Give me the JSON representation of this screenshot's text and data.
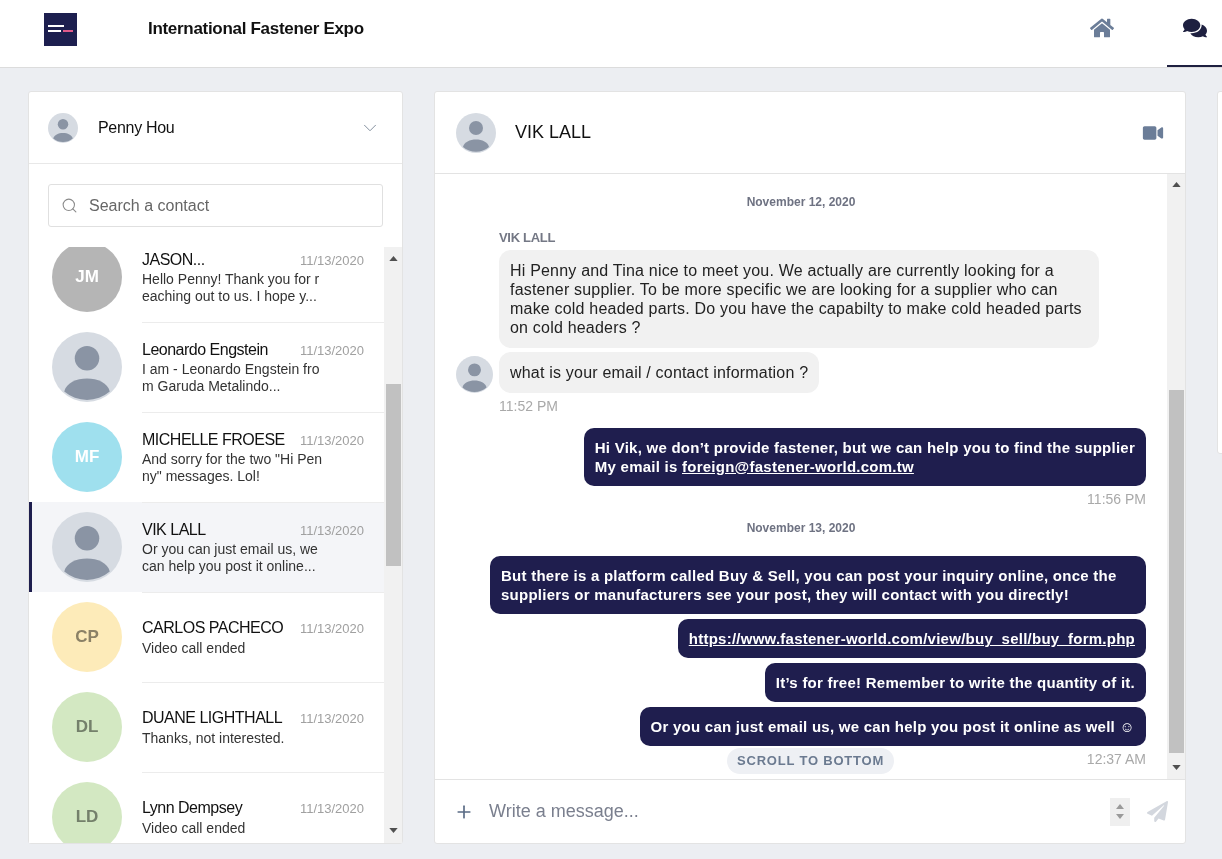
{
  "header": {
    "title": "International Fastener Expo",
    "nav": [
      {
        "kind": "home",
        "selected": false
      },
      {
        "kind": "chat",
        "selected": true
      }
    ]
  },
  "user": {
    "name": "Penny Hou"
  },
  "search": {
    "placeholder": "Search a contact"
  },
  "contacts": [
    {
      "name": "JASON...",
      "date": "11/13/2020",
      "preview": "Hello Penny! Thank you for reaching out to us. I hope y...",
      "avatar": {
        "kind": "initials",
        "initials": "JM",
        "color": "#b5b5b5"
      },
      "selected": false
    },
    {
      "name": "Leonardo Engstein",
      "date": "11/13/2020",
      "preview": "I am - Leonardo Engstein from Garuda Metalindo...",
      "avatar": {
        "kind": "photo"
      },
      "selected": false
    },
    {
      "name": "MICHELLE FROESE",
      "date": "11/13/2020",
      "preview": "And sorry for the two \"Hi Penny\" messages. Lol!",
      "avatar": {
        "kind": "initials",
        "initials": "MF",
        "color": "#9fe0ee"
      },
      "selected": false
    },
    {
      "name": "VIK LALL",
      "date": "11/13/2020",
      "preview": "Or you can just email us, we can help you post it online...",
      "avatar": {
        "kind": "photo"
      },
      "selected": true
    },
    {
      "name": "CARLOS PACHECO",
      "date": "11/13/2020",
      "preview": "Video call ended",
      "avatar": {
        "kind": "initials",
        "initials": "CP",
        "color": "#fdebb9"
      },
      "selected": false
    },
    {
      "name": "DUANE LIGHTHALL",
      "date": "11/13/2020",
      "preview": "Thanks, not interested.",
      "avatar": {
        "kind": "initials",
        "initials": "DL",
        "color": "#d3e8c2"
      },
      "selected": false
    },
    {
      "name": "Lynn Dempsey",
      "date": "11/13/2020",
      "preview": "Video call ended",
      "avatar": {
        "kind": "initials",
        "initials": "LD",
        "color": "#d3e8c2"
      },
      "selected": false
    }
  ],
  "chat": {
    "contact": {
      "name": "VIK LALL"
    },
    "messages": [
      {
        "kind": "date",
        "text": "November 12, 2020"
      },
      {
        "kind": "sender",
        "text": "VIK LALL"
      },
      {
        "kind": "incoming",
        "text": "Hi Penny and Tina nice to meet you. We actually are currently looking for a fastener supplier. To be more specific we are looking for a supplier who can make cold headed parts. Do you have the capabilty to make cold headed parts on cold headers ?",
        "avatar": false
      },
      {
        "kind": "incoming",
        "text": "what is your email / contact information ?",
        "avatar": true
      },
      {
        "kind": "time",
        "text": "11:52 PM"
      },
      {
        "kind": "outgoing",
        "text": "Hi Vik, we don’t provide fastener, but we can help you to find the supplier\nMy email is",
        "link": "foreign@fastener-world.com.tw"
      },
      {
        "kind": "time",
        "text": "11:56 PM"
      },
      {
        "kind": "date",
        "text": "November 13, 2020"
      },
      {
        "kind": "outgoing",
        "text": "But there is a platform called Buy & Sell, you can post your inquiry online, once the suppliers or manufacturers see your post, they will contact with you directly!"
      },
      {
        "kind": "outgoing",
        "link": "https://www.fastener-world.com/view/buy_sell/buy_form.php"
      },
      {
        "kind": "outgoing",
        "text": "It’s for free! Remember to write the quantity of it."
      },
      {
        "kind": "outgoing",
        "text": "Or you can just email us, we can help you post it online as well ☺"
      },
      {
        "kind": "time",
        "text": "12:37 AM"
      }
    ],
    "scroll_button": "SCROLL TO BOTTOM",
    "composer": {
      "placeholder": "Write a message...",
      "send_disabled": true
    }
  }
}
